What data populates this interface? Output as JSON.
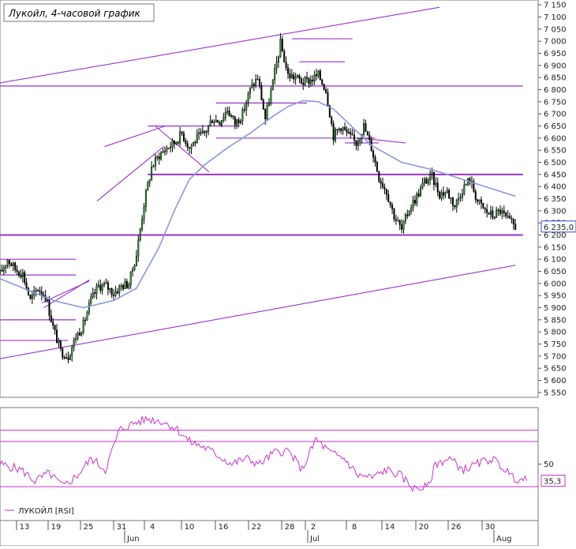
{
  "chart_data": [
    {
      "type": "candlestick",
      "title": "Лукойл, 4-часовой график",
      "ylim": [
        5530,
        7170
      ],
      "y_ticks": [
        5550,
        5600,
        5650,
        5700,
        5750,
        5800,
        5850,
        5900,
        5950,
        6000,
        6050,
        6100,
        6150,
        6200,
        6250,
        6300,
        6350,
        6400,
        6450,
        6500,
        6550,
        6600,
        6650,
        6700,
        6750,
        6800,
        6850,
        6900,
        6950,
        7000,
        7050,
        7100,
        7150
      ],
      "y_tick_labels": [
        "5 550",
        "5 600",
        "5 650",
        "5 700",
        "5 750",
        "5 800",
        "5 850",
        "5 900",
        "5 950",
        "6 000",
        "6 050",
        "6 100",
        "6 150",
        "6 200",
        "6 250",
        "6 300",
        "6 350",
        "6 400",
        "6 450",
        "6 500",
        "6 550",
        "6 600",
        "6 650",
        "6 700",
        "6 750",
        "6 800",
        "6 850",
        "6 900",
        "6 950",
        "7 000",
        "7 050",
        "7 100",
        "7 150"
      ],
      "last_value": 6235,
      "last_value_label": "6 235,0",
      "x_days": [
        13,
        19,
        25,
        31,
        4,
        10,
        16,
        22,
        28,
        2,
        8,
        14,
        20,
        26,
        30
      ],
      "x_day_labels": [
        "13",
        "19",
        "25",
        "31",
        "4",
        "10",
        "16",
        "22",
        "28",
        "2",
        "8",
        "14",
        "20",
        "26",
        "30"
      ],
      "x_months": [
        {
          "label": "Jun",
          "day": 31.5
        },
        {
          "label": "Jul",
          "day": 60.5
        },
        {
          "label": "Aug",
          "day": 91.5
        }
      ],
      "close_anchors": [
        [
          7,
          6040
        ],
        [
          8,
          6100
        ],
        [
          9,
          6060
        ],
        [
          10,
          6040
        ],
        [
          11,
          5930
        ],
        [
          12,
          5980
        ],
        [
          13,
          5950
        ],
        [
          14,
          5820
        ],
        [
          15,
          5720
        ],
        [
          16,
          5700
        ],
        [
          17,
          5780
        ],
        [
          18,
          5830
        ],
        [
          19,
          5930
        ],
        [
          20,
          5990
        ],
        [
          21,
          5990
        ],
        [
          22,
          5960
        ],
        [
          23,
          5990
        ],
        [
          24,
          6000
        ],
        [
          25,
          6120
        ],
        [
          26,
          6330
        ],
        [
          27,
          6480
        ],
        [
          28,
          6530
        ],
        [
          29,
          6560
        ],
        [
          30,
          6580
        ],
        [
          31,
          6620
        ],
        [
          32,
          6560
        ],
        [
          33,
          6600
        ],
        [
          34,
          6620
        ],
        [
          35,
          6680
        ],
        [
          36,
          6670
        ],
        [
          37,
          6720
        ],
        [
          38,
          6660
        ],
        [
          39,
          6700
        ],
        [
          40,
          6800
        ],
        [
          41,
          6850
        ],
        [
          42,
          6680
        ],
        [
          43,
          6830
        ],
        [
          44,
          6990
        ],
        [
          45,
          6860
        ],
        [
          46,
          6850
        ],
        [
          47,
          6830
        ],
        [
          48,
          6840
        ],
        [
          49,
          6860
        ],
        [
          50,
          6800
        ],
        [
          51,
          6610
        ],
        [
          52,
          6650
        ],
        [
          53,
          6610
        ],
        [
          54,
          6580
        ],
        [
          55,
          6650
        ],
        [
          56,
          6560
        ],
        [
          57,
          6440
        ],
        [
          58,
          6380
        ],
        [
          59,
          6280
        ],
        [
          60,
          6220
        ],
        [
          61,
          6310
        ],
        [
          62,
          6360
        ],
        [
          63,
          6420
        ],
        [
          64,
          6440
        ],
        [
          65,
          6370
        ],
        [
          66,
          6380
        ],
        [
          67,
          6320
        ],
        [
          68,
          6390
        ],
        [
          69,
          6430
        ],
        [
          70,
          6340
        ],
        [
          71,
          6300
        ],
        [
          72,
          6280
        ],
        [
          73,
          6300
        ],
        [
          74,
          6260
        ],
        [
          75,
          6235
        ]
      ],
      "ma_anchors": [
        [
          7,
          6020
        ],
        [
          14,
          5930
        ],
        [
          18,
          5900
        ],
        [
          22,
          5930
        ],
        [
          25,
          5980
        ],
        [
          28,
          6150
        ],
        [
          30,
          6300
        ],
        [
          32,
          6430
        ],
        [
          34,
          6490
        ],
        [
          37,
          6560
        ],
        [
          40,
          6620
        ],
        [
          43,
          6690
        ],
        [
          45,
          6730
        ],
        [
          47,
          6755
        ],
        [
          49,
          6750
        ],
        [
          51,
          6720
        ],
        [
          53,
          6660
        ],
        [
          56,
          6570
        ],
        [
          60,
          6500
        ],
        [
          64,
          6470
        ],
        [
          68,
          6430
        ],
        [
          72,
          6390
        ],
        [
          75,
          6360
        ]
      ],
      "hlines": [
        {
          "y": 6815,
          "x": [
            0,
            76
          ]
        },
        {
          "y": 6200,
          "x": [
            0,
            76
          ]
        },
        {
          "y": 7010,
          "x": [
            45.5,
            53.5
          ]
        },
        {
          "y": 6915,
          "x": [
            46.5,
            52.5
          ]
        },
        {
          "y": 6450,
          "x": [
            26.5,
            76
          ]
        },
        {
          "y": 6650,
          "x": [
            26.5,
            38.5
          ]
        },
        {
          "y": 6745,
          "x": [
            35.5,
            47.5
          ]
        },
        {
          "y": 6600,
          "x": [
            35.5,
            56.5
          ]
        },
        {
          "y": 6100,
          "x": [
            0,
            17
          ]
        },
        {
          "y": 6035,
          "x": [
            4.5,
            17
          ]
        },
        {
          "y": 5850,
          "x": [
            4.5,
            17
          ]
        },
        {
          "y": 5950,
          "x": [
            0,
            4
          ]
        },
        {
          "y": 5765,
          "x": [
            0,
            16
          ]
        },
        {
          "y": 6580,
          "x": [
            52.5,
            57
          ]
        }
      ],
      "trendlines": [
        {
          "from": [
            0,
            6790
          ],
          "to": [
            65,
            7140
          ]
        },
        {
          "from": [
            0,
            5650
          ],
          "to": [
            75,
            6075
          ]
        },
        {
          "from": [
            19.8,
            6340
          ],
          "to": [
            28.6,
            6565
          ]
        },
        {
          "from": [
            27.5,
            6650
          ],
          "to": [
            34.6,
            6460
          ]
        },
        {
          "from": [
            20.8,
            6565
          ],
          "to": [
            28.8,
            6650
          ]
        },
        {
          "from": [
            12.5,
            5920
          ],
          "to": [
            18.8,
            6010
          ]
        },
        {
          "from": [
            12.8,
            5900
          ],
          "to": [
            18.8,
            6015
          ]
        },
        {
          "from": [
            54.5,
            6600
          ],
          "to": [
            60.5,
            6580
          ]
        }
      ]
    },
    {
      "type": "line",
      "legend": "ЛУКОЙЛ [RSI]",
      "ylim": [
        0,
        100
      ],
      "y_ticks": [
        50
      ],
      "y_tick_labels": [
        "50"
      ],
      "last_value": 35.3,
      "last_value_label": "35,3",
      "levels": [
        80,
        70,
        30
      ],
      "rsi_anchors": [
        [
          0,
          50
        ],
        [
          3,
          45
        ],
        [
          5,
          35
        ],
        [
          7,
          42
        ],
        [
          9,
          30
        ],
        [
          11,
          40
        ],
        [
          13,
          55
        ],
        [
          15,
          45
        ],
        [
          17,
          80
        ],
        [
          19,
          86
        ],
        [
          21,
          90
        ],
        [
          23,
          88
        ],
        [
          25,
          82
        ],
        [
          27,
          70
        ],
        [
          29,
          65
        ],
        [
          31,
          58
        ],
        [
          33,
          50
        ],
        [
          35,
          55
        ],
        [
          37,
          50
        ],
        [
          39,
          60
        ],
        [
          41,
          62
        ],
        [
          43,
          45
        ],
        [
          45,
          72
        ],
        [
          47,
          60
        ],
        [
          49,
          55
        ],
        [
          51,
          40
        ],
        [
          53,
          38
        ],
        [
          55,
          45
        ],
        [
          57,
          40
        ],
        [
          59,
          28
        ],
        [
          61,
          30
        ],
        [
          62,
          50
        ],
        [
          64,
          55
        ],
        [
          66,
          45
        ],
        [
          68,
          50
        ],
        [
          70,
          55
        ],
        [
          72,
          45
        ],
        [
          73,
          38
        ],
        [
          75,
          35.3
        ]
      ],
      "line_color": "#cc33cc",
      "level_color": "#cc33cc"
    }
  ],
  "colors": {
    "bull": "#22aa22",
    "bear": "#000000",
    "ma": "#8899dd",
    "level": "#9933cc",
    "label_bg": "#ffffff"
  }
}
